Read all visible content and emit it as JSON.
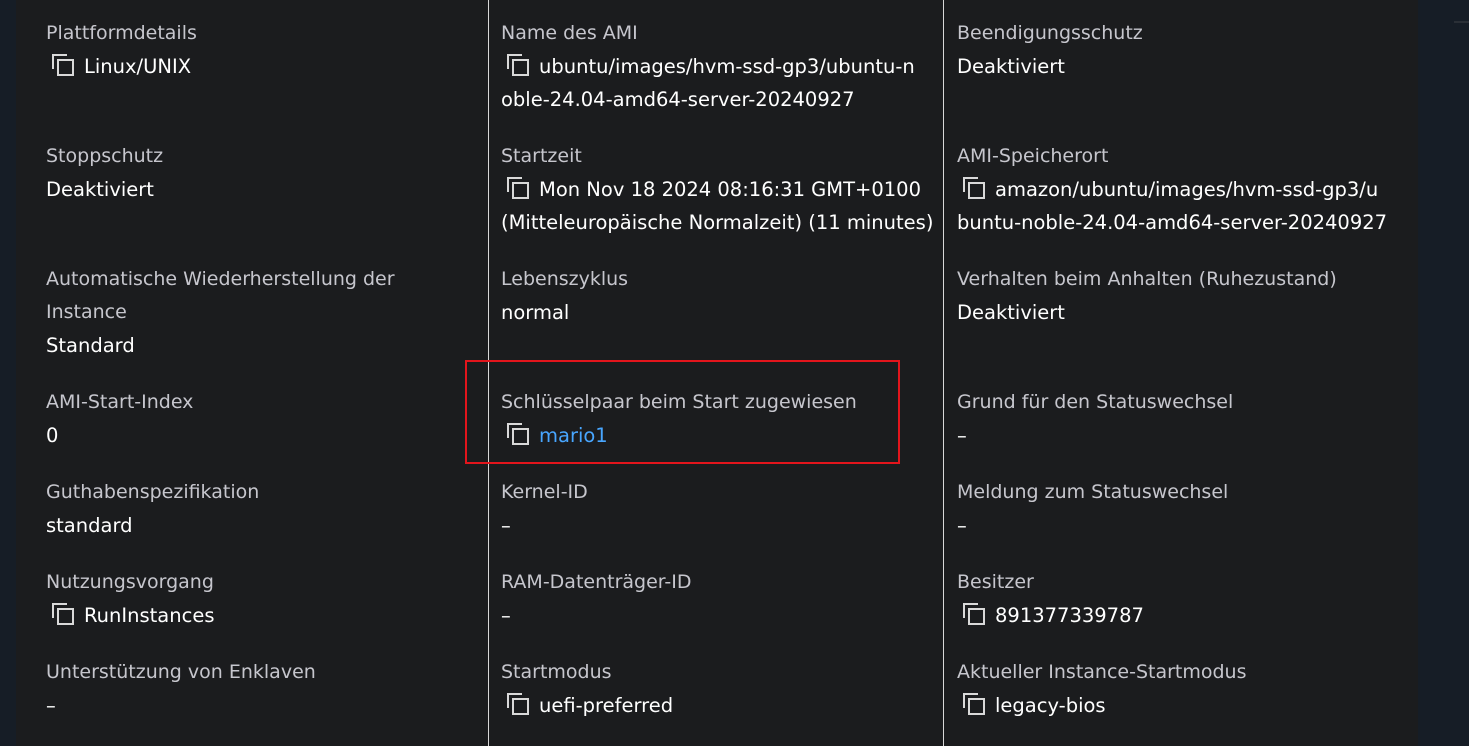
{
  "columns": [
    [
      {
        "label": "Plattformdetails",
        "value_lines": [
          "Linux/UNIX"
        ],
        "copyable": true
      },
      {
        "label": "Stoppschutz",
        "value_lines": [
          "Deaktiviert"
        ],
        "copyable": false
      },
      {
        "label_lines": [
          "Automatische Wiederherstellung der",
          "Instance"
        ],
        "value_lines": [
          "Standard"
        ],
        "copyable": false
      },
      {
        "label": "AMI-Start-Index",
        "value_lines": [
          "0"
        ],
        "copyable": false
      },
      {
        "label": "Guthabenspezifikation",
        "value_lines": [
          "standard"
        ],
        "copyable": false
      },
      {
        "label": "Nutzungsvorgang",
        "value_lines": [
          "RunInstances"
        ],
        "copyable": true
      },
      {
        "label": "Unterstützung von Enklaven",
        "value_lines": [
          "–"
        ],
        "copyable": false
      }
    ],
    [
      {
        "label": "Name des AMI",
        "value_lines": [
          "ubuntu/images/hvm-ssd-gp3/ubuntu-n",
          "oble-24.04-amd64-server-20240927"
        ],
        "copyable": true
      },
      {
        "label": "Startzeit",
        "value_lines": [
          "Mon Nov 18 2024 08:16:31 GMT+0100",
          "(Mitteleuropäische Normalzeit) (11 minutes)"
        ],
        "copyable": true
      },
      {
        "label": "Lebenszyklus",
        "value_lines": [
          "normal"
        ],
        "copyable": false
      },
      {
        "label": "Schlüsselpaar beim Start zugewiesen",
        "value_lines": [
          "mario1"
        ],
        "copyable": true,
        "link": true
      },
      {
        "label": "Kernel-ID",
        "value_lines": [
          "–"
        ],
        "copyable": false
      },
      {
        "label": "RAM-Datenträger-ID",
        "value_lines": [
          "–"
        ],
        "copyable": false
      },
      {
        "label": "Startmodus",
        "value_lines": [
          "uefi-preferred"
        ],
        "copyable": true
      }
    ],
    [
      {
        "label": "Beendigungsschutz",
        "value_lines": [
          "Deaktiviert"
        ],
        "copyable": false
      },
      {
        "label": "AMI-Speicherort",
        "value_lines": [
          "amazon/ubuntu/images/hvm-ssd-gp3/u",
          "buntu-noble-24.04-amd64-server-20240927"
        ],
        "copyable": true
      },
      {
        "label": "Verhalten beim Anhalten (Ruhezustand)",
        "value_lines": [
          "Deaktiviert"
        ],
        "copyable": false
      },
      {
        "label": "Grund für den Statuswechsel",
        "value_lines": [
          "–"
        ],
        "copyable": false
      },
      {
        "label": "Meldung zum Statuswechsel",
        "value_lines": [
          "–"
        ],
        "copyable": false
      },
      {
        "label": "Besitzer",
        "value_lines": [
          "891377339787"
        ],
        "copyable": true
      },
      {
        "label": "Aktueller Instance-Startmodus",
        "value_lines": [
          "legacy-bios"
        ],
        "copyable": true
      }
    ]
  ],
  "colors": {
    "link": "#48a6ff",
    "highlight": "#e3151c",
    "panel": "#1b1c1e"
  }
}
